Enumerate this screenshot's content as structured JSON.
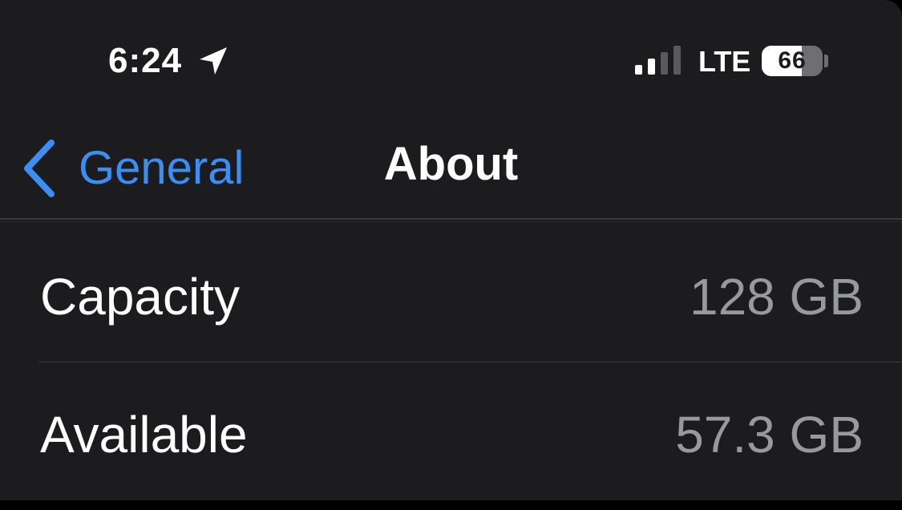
{
  "status_bar": {
    "time": "6:24",
    "location_icon": "location-arrow-icon",
    "signal_icon": "cellular-signal-icon",
    "signal_bars_active": 2,
    "signal_bars_total": 4,
    "network": "LTE",
    "battery_icon": "battery-icon",
    "battery_level": "66",
    "battery_fraction": 0.66
  },
  "nav": {
    "back_icon": "chevron-left-icon",
    "back_label": "General",
    "title": "About"
  },
  "rows": [
    {
      "label": "Capacity",
      "value": "128 GB"
    },
    {
      "label": "Available",
      "value": "57.3 GB"
    }
  ],
  "colors": {
    "background": "#1c1c1e",
    "accent": "#3a8ff5",
    "primary_text": "#ffffff",
    "secondary_text": "#98989f",
    "separator": "#3a3a3c",
    "signal_active": "#ffffff",
    "signal_inactive": "#5a5a5e"
  }
}
